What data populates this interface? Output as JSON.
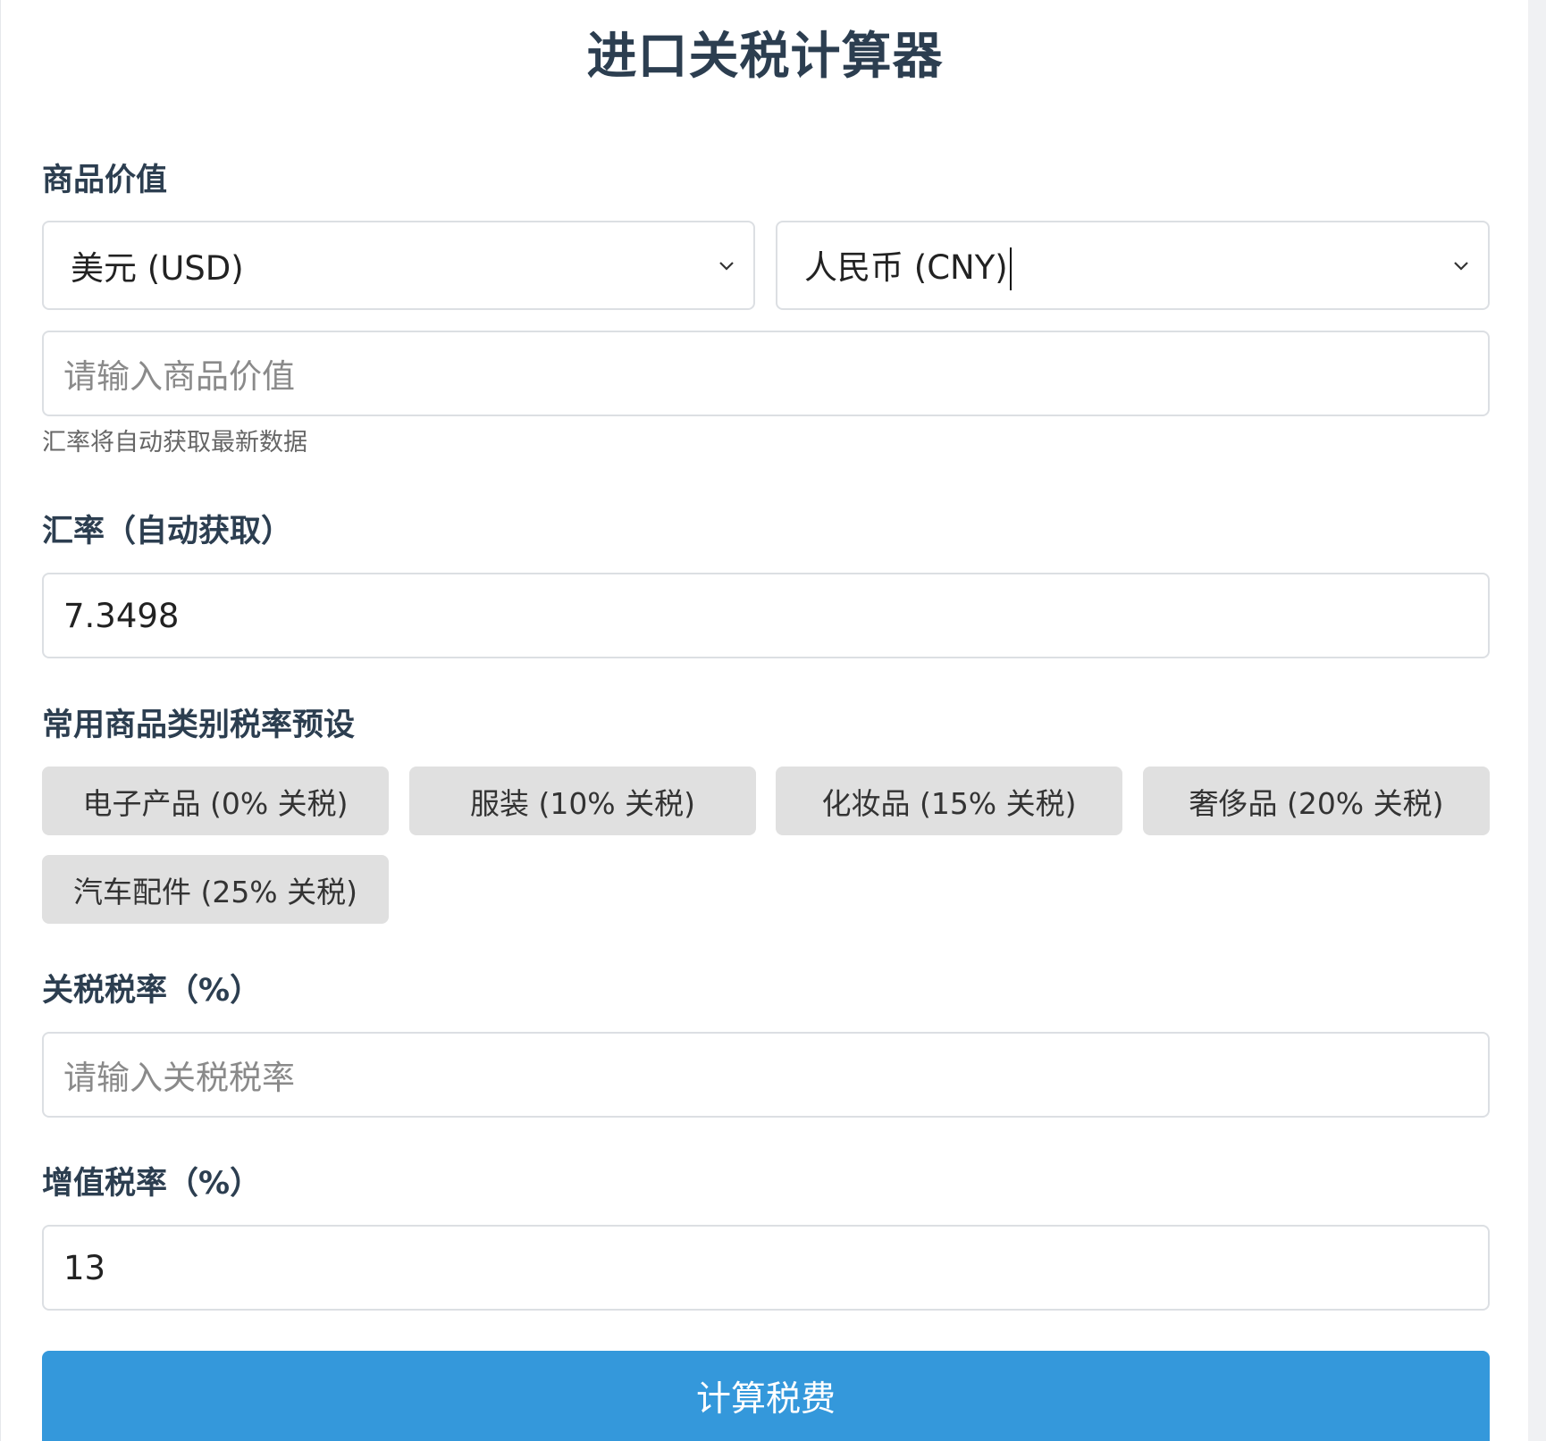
{
  "title": "进口关税计算器",
  "goods_value": {
    "label": "商品价值",
    "from_currency": "美元 (USD)",
    "to_currency": "人民币 (CNY)",
    "value_placeholder": "请输入商品价值",
    "hint": "汇率将自动获取最新数据"
  },
  "exchange_rate": {
    "label": "汇率（自动获取）",
    "value": "7.3498"
  },
  "presets": {
    "label": "常用商品类别税率预设",
    "items": [
      {
        "label": "电子产品 (0% 关税)"
      },
      {
        "label": "服装 (10% 关税)"
      },
      {
        "label": "化妆品 (15% 关税)"
      },
      {
        "label": "奢侈品 (20% 关税)"
      },
      {
        "label": "汽车配件 (25% 关税)"
      }
    ]
  },
  "tariff_rate": {
    "label": "关税税率（%）",
    "placeholder": "请输入关税税率"
  },
  "vat_rate": {
    "label": "增值税率（%）",
    "value": "13"
  },
  "calculate_button": "计算税费",
  "colors": {
    "primary": "#3498db",
    "heading": "#2c3e50",
    "preset_bg": "#e0e0e0"
  }
}
